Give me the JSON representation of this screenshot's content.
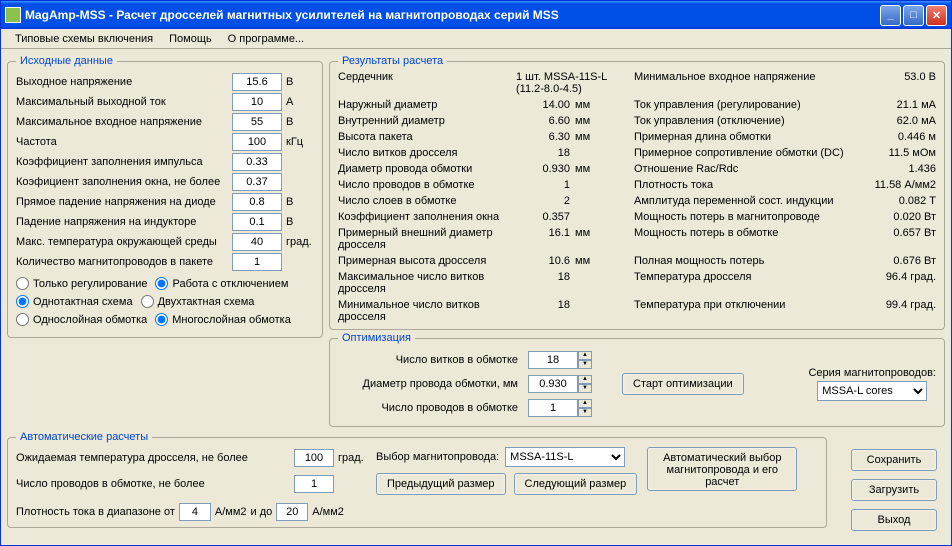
{
  "window": {
    "title": "MagAmp-MSS  -  Расчет дросселей магнитных усилителей на магнитопроводах серий MSS"
  },
  "menu": {
    "scheme": "Типовые схемы включения",
    "help": "Помощь",
    "about": "О программе..."
  },
  "input": {
    "legend": "Исходные данные",
    "vout_l": "Выходное напряжение",
    "vout_v": "15.6",
    "vout_u": "В",
    "iout_l": "Максимальный выходной ток",
    "iout_v": "10",
    "iout_u": "А",
    "vin_l": "Максимальное входное напряжение",
    "vin_v": "55",
    "vin_u": "В",
    "freq_l": "Частота",
    "freq_v": "100",
    "freq_u": "кГц",
    "duty_l": "Коэффициент заполнения импульса",
    "duty_v": "0.33",
    "wfill_l": "Коэфициент заполнения окна, не более",
    "wfill_v": "0.37",
    "vd_l": "Прямое падение напряжения на диоде",
    "vd_v": "0.8",
    "vd_u": "В",
    "vl_l": "Падение напряжения на индукторе",
    "vl_v": "0.1",
    "vl_u": "В",
    "ta_l": "Макс. температура окружающей среды",
    "ta_v": "40",
    "ta_u": "град.",
    "ncore_l": "Количество магнитопроводов  в пакете",
    "ncore_v": "1",
    "radio": {
      "reg_only": "Только регулирование",
      "with_off": "Работа с отключением",
      "single": "Однотактная схема",
      "double": "Двухтактная схема",
      "single_layer": "Однослойная обмотка",
      "multi_layer": "Многослойная обмотка"
    }
  },
  "results": {
    "legend": "Результаты расчета",
    "rows": [
      {
        "l1": "Сердечник",
        "v1": "1 шт. MSSA-11S-L (11.2-8.0-4.5)",
        "u1": "",
        "l2": "Минимальное входное напряжение",
        "v2": "53.0",
        "u2": "В"
      },
      {
        "l1": "Наружный диаметр",
        "v1": "14.00",
        "u1": "мм",
        "l2": "Ток управления (регулирование)",
        "v2": "21.1",
        "u2": "мА"
      },
      {
        "l1": "Внутренний диаметр",
        "v1": "6.60",
        "u1": "мм",
        "l2": "Ток управления (отключение)",
        "v2": "62.0",
        "u2": "мА"
      },
      {
        "l1": "Высота пакета",
        "v1": "6.30",
        "u1": "мм",
        "l2": "Примерная длина обмотки",
        "v2": "0.446",
        "u2": "м"
      },
      {
        "l1": "Число витков дросселя",
        "v1": "18",
        "u1": "",
        "l2": "Примерное сопротивление обмотки (DC)",
        "v2": "11.5",
        "u2": "мОм"
      },
      {
        "l1": "Диаметр провода обмотки",
        "v1": "0.930",
        "u1": "мм",
        "l2": "Отношение Rac/Rdc",
        "v2": "1.436",
        "u2": ""
      },
      {
        "l1": "Число проводов в обмотке",
        "v1": "1",
        "u1": "",
        "l2": "Плотность тока",
        "v2": "11.58",
        "u2": "А/мм2"
      },
      {
        "l1": "Число слоев в обмотке",
        "v1": "2",
        "u1": "",
        "l2": "Амплитуда переменной сост. индукции",
        "v2": "0.082",
        "u2": "Т"
      },
      {
        "l1": "Коэффициент заполнения окна",
        "v1": "0.357",
        "u1": "",
        "l2": "Мощность потерь в магнитопроводе",
        "v2": "0.020",
        "u2": "Вт"
      },
      {
        "l1": "Примерный внешний диаметр дросселя",
        "v1": "16.1",
        "u1": "мм",
        "l2": "Мощность потерь в обмотке",
        "v2": "0.657",
        "u2": "Вт"
      },
      {
        "l1": "Примерная высота дросселя",
        "v1": "10.6",
        "u1": "мм",
        "l2": "Полная мощность потерь",
        "v2": "0.676",
        "u2": "Вт"
      },
      {
        "l1": "Максимальное число витков дросселя",
        "v1": "18",
        "u1": "",
        "l2": "Температура дросселя",
        "v2": "96.4",
        "u2": "град."
      },
      {
        "l1": "Минимальное число витков дросселя",
        "v1": "18",
        "u1": "",
        "l2": "Температура при отключении",
        "v2": "99.4",
        "u2": "град."
      }
    ]
  },
  "opt": {
    "legend": "Оптимизация",
    "turns_l": "Число витков в обмотке",
    "turns_v": "18",
    "wdia_l": "Диаметр провода обмотки, мм",
    "wdia_v": "0.930",
    "nwires_l": "Число проводов в обмотке",
    "nwires_v": "1",
    "start_btn": "Старт оптимизации",
    "series_l": "Серия магнитопроводов:",
    "series_v": "MSSA-L cores"
  },
  "auto": {
    "legend": "Автоматические расчеты",
    "texp_l": "Ожидаемая температура дросселя, не более",
    "texp_v": "100",
    "texp_u": "град.",
    "nwire_l": "Число проводов в обмотке, не более",
    "nwire_v": "1",
    "jrange_l": "Плотность тока в диапазоне от",
    "jfrom_v": "4",
    "j_u": "А/мм2",
    "jto_l": "и до",
    "jto_v": "20",
    "core_sel_l": "Выбор магнитопровода:",
    "core_sel_v": "MSSA-11S-L",
    "prev_btn": "Предыдущий размер",
    "next_btn": "Следующий размер",
    "auto_btn": "Автоматический выбор магнитопровода и его расчет"
  },
  "side": {
    "save": "Сохранить",
    "load": "Загрузить",
    "exit": "Выход"
  }
}
